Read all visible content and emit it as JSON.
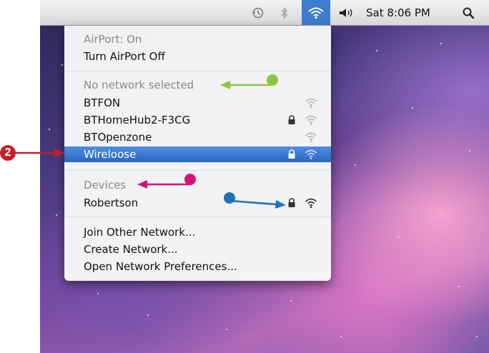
{
  "menubar": {
    "clock": "Sat 8:06 PM",
    "icons": [
      "time-machine-icon",
      "bluetooth-icon",
      "wifi-icon",
      "volume-icon",
      "spotlight-icon"
    ]
  },
  "airport_menu": {
    "status": "AirPort: On",
    "toggle": "Turn AirPort Off",
    "networks_header": "No network selected",
    "networks": [
      {
        "name": "BTFON",
        "locked": false,
        "selected": false
      },
      {
        "name": "BTHomeHub2-F3CG",
        "locked": true,
        "selected": false
      },
      {
        "name": "BTOpenzone",
        "locked": false,
        "selected": false
      },
      {
        "name": "Wireloose",
        "locked": true,
        "selected": true
      }
    ],
    "devices_header": "Devices",
    "devices": [
      {
        "name": "Robertson",
        "locked": true
      }
    ],
    "actions": [
      "Join Other Network...",
      "Create Network...",
      "Open Network Preferences..."
    ]
  },
  "annotations": {
    "step_number": "2",
    "colors": {
      "step": "#c41e2a",
      "network_pointer": "#8cc63f",
      "devices_pointer": "#d6117a",
      "security_pointer": "#1f73b7"
    }
  },
  "colors": {
    "highlight": "#3d7ccf",
    "menu_background": "#f8f8f8"
  }
}
